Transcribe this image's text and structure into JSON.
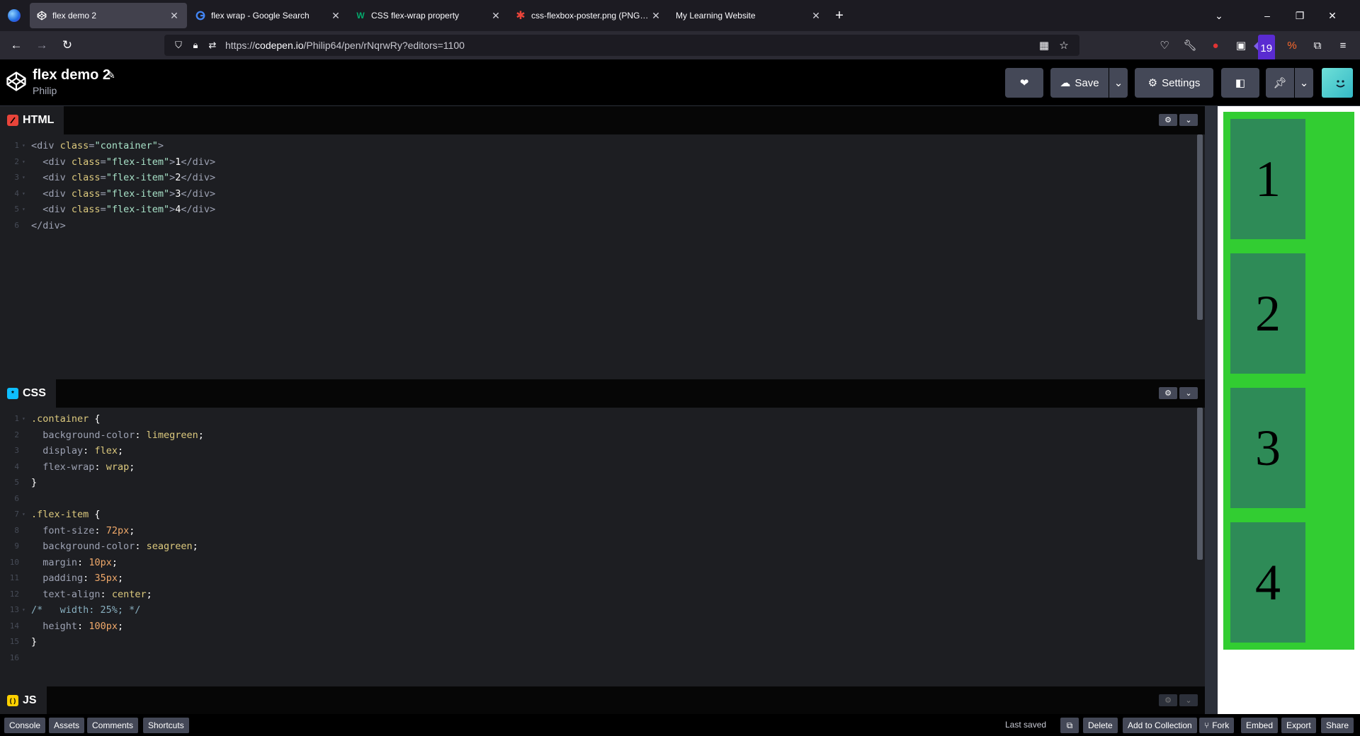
{
  "browser": {
    "tabs": [
      {
        "title": "flex demo 2",
        "active": true,
        "favicon": "codepen-icon"
      },
      {
        "title": "flex wrap - Google Search",
        "active": false,
        "favicon": "google-icon"
      },
      {
        "title": "CSS flex-wrap property",
        "active": false,
        "favicon": "w3schools-icon"
      },
      {
        "title": "css-flexbox-poster.png (PNG Im",
        "active": false,
        "favicon": "asterisk-icon"
      },
      {
        "title": "My Learning Website",
        "active": false,
        "favicon": "none"
      }
    ],
    "url_prefix": "https://",
    "url_host": "codepen.io",
    "url_path": "/Philip64/pen/rNqrwRy?editors=1100",
    "extension_badge": "19"
  },
  "codepen": {
    "pen_title": "flex demo 2",
    "owner": "Philip",
    "save_label": "Save",
    "settings_label": "Settings"
  },
  "editors": {
    "html": {
      "label": "HTML",
      "lines": [
        {
          "n": "1",
          "fold": true
        },
        {
          "n": "2",
          "fold": true
        },
        {
          "n": "3",
          "fold": true
        },
        {
          "n": "4",
          "fold": true
        },
        {
          "n": "5",
          "fold": true
        },
        {
          "n": "6",
          "fold": false
        }
      ],
      "code": [
        "<div class=\"container\">",
        "  <div class=\"flex-item\">1</div>",
        "  <div class=\"flex-item\">2</div>",
        "  <div class=\"flex-item\">3</div>",
        "  <div class=\"flex-item\">4</div>",
        "</div>"
      ]
    },
    "css": {
      "label": "CSS",
      "code": [
        ".container {",
        "  background-color: limegreen;",
        "  display: flex;",
        "  flex-wrap: wrap;",
        "}",
        "",
        ".flex-item {",
        "  font-size: 72px;",
        "  background-color: seagreen;",
        "  margin: 10px;",
        "  padding: 35px;",
        "  text-align: center;",
        "/*   width: 25%; */",
        "  height: 100px;",
        "}",
        ""
      ]
    },
    "js": {
      "label": "JS"
    }
  },
  "result": {
    "container_color": "#32cd32",
    "item_color": "#2e8b57",
    "items": [
      "1",
      "2",
      "3",
      "4"
    ]
  },
  "footer": {
    "console": "Console",
    "assets": "Assets",
    "comments": "Comments",
    "shortcuts": "Shortcuts",
    "last_saved": "Last saved",
    "delete": "Delete",
    "add_to_collection": "Add to Collection",
    "fork": "Fork",
    "embed": "Embed",
    "export": "Export",
    "share": "Share"
  }
}
